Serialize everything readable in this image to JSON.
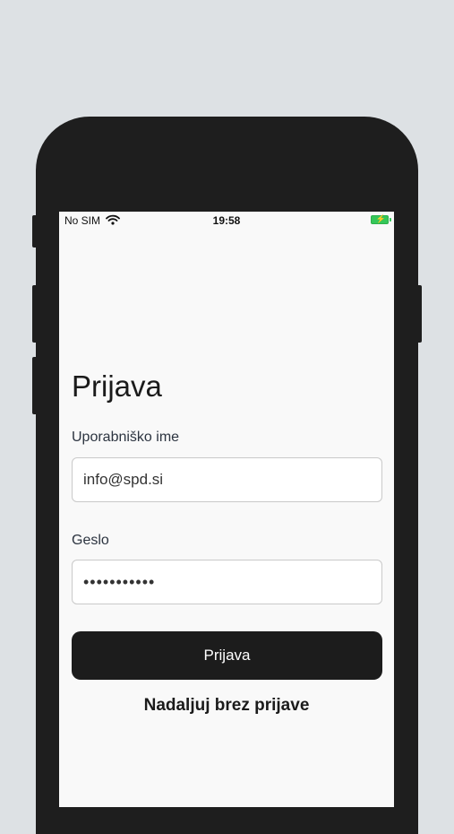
{
  "status_bar": {
    "carrier": "No SIM",
    "time": "19:58",
    "wifi_icon": "wifi-icon",
    "battery_icon": "battery-charging-icon"
  },
  "login": {
    "title": "Prijava",
    "username_label": "Uporabniško ime",
    "username_value": "info@spd.si",
    "password_label": "Geslo",
    "password_value": "•••••••••••",
    "submit_label": "Prijava",
    "guest_label": "Nadaljuj brez prijave"
  },
  "colors": {
    "background": "#dde1e4",
    "device": "#1e1e1e",
    "screen": "#f9f9f9",
    "button": "#1c1c1c",
    "battery": "#35c759"
  }
}
